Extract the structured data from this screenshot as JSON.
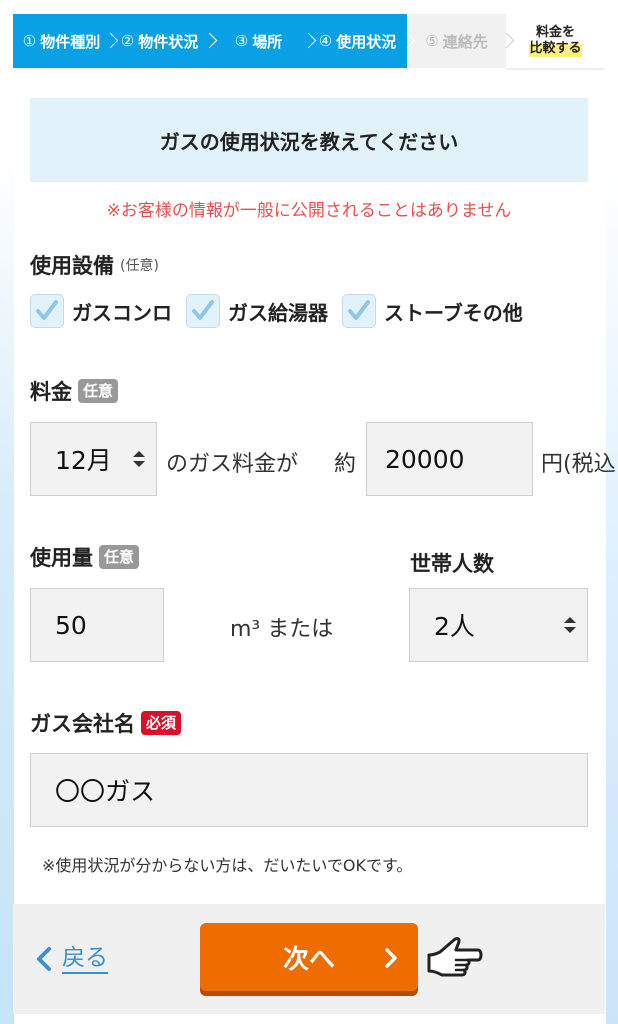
{
  "steps": [
    {
      "num": "①",
      "label": "物件種別",
      "state": "active"
    },
    {
      "num": "②",
      "label": "物件状況",
      "state": "active"
    },
    {
      "num": "③",
      "label": "場所",
      "state": "active"
    },
    {
      "num": "④",
      "label": "使用状況",
      "state": "active"
    },
    {
      "num": "⑤",
      "label": "連絡先",
      "state": "inactive"
    }
  ],
  "compare_line1": "料金を",
  "compare_line2": "比較する",
  "banner_title": "ガスの使用状況を教えてください",
  "privacy_notice": "※お客様の情報が一般に公開されることはありません",
  "equipment": {
    "label": "使用設備",
    "optional": "(任意)",
    "options": [
      {
        "label": "ガスコンロ",
        "checked": true
      },
      {
        "label": "ガス給湯器",
        "checked": true
      },
      {
        "label": "ストーブその他",
        "checked": true
      }
    ]
  },
  "fee": {
    "label": "料金",
    "tag": "任意",
    "month": "12月",
    "text_mid": "のガス料金が",
    "text_approx": "約",
    "amount": "20000",
    "unit": "円(税込"
  },
  "usage": {
    "label": "使用量",
    "tag": "任意",
    "value": "50",
    "unit": "m³ または"
  },
  "household": {
    "label": "世帯人数",
    "value": "2人"
  },
  "company": {
    "label": "ガス会社名",
    "tag": "必須",
    "value": "〇〇ガス"
  },
  "footer_note": "※使用状況が分からない方は、だいたいでOKです。",
  "back_label": "戻る",
  "next_label": "次へ",
  "colors": {
    "primary": "#0aa0e6",
    "accent": "#ef6c00",
    "required": "#d8102a",
    "notice": "#e8504f"
  }
}
